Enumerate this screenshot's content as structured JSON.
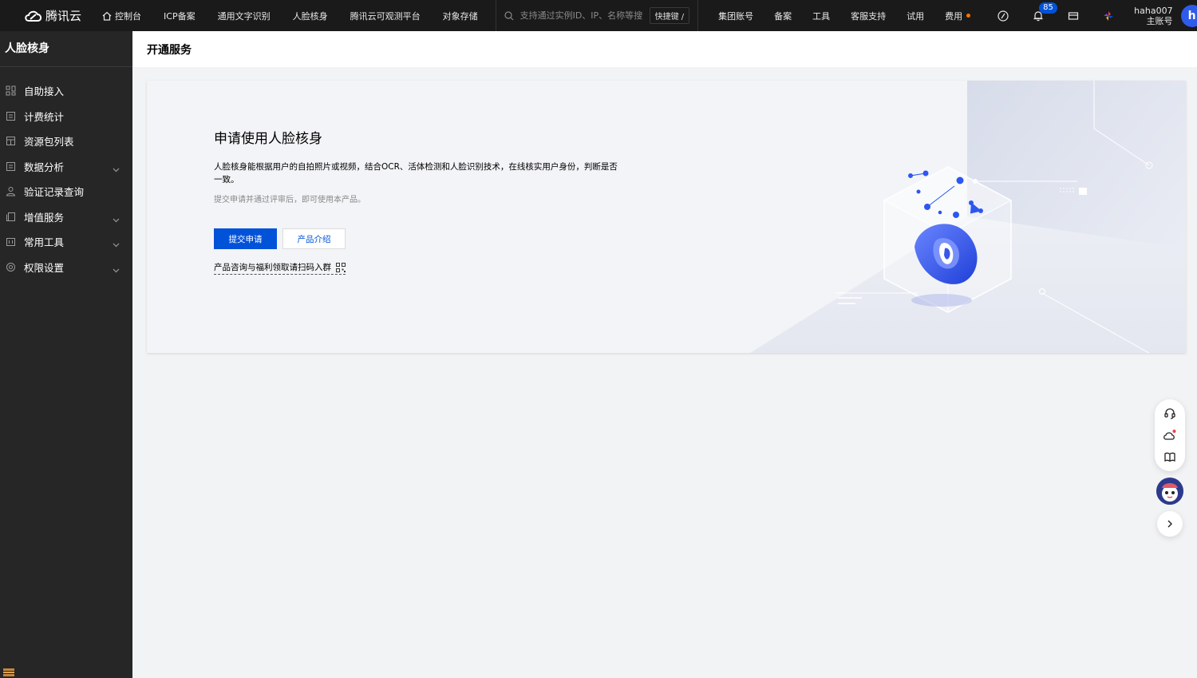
{
  "topbar": {
    "logo_text": "腾讯云",
    "nav": [
      {
        "label": "控制台",
        "icon": "home-icon"
      },
      {
        "label": "ICP备案"
      },
      {
        "label": "通用文字识别"
      },
      {
        "label": "人脸核身"
      },
      {
        "label": "腾讯云可观测平台"
      },
      {
        "label": "对象存储"
      }
    ],
    "search_placeholder": "支持通过实例ID、IP、名称等搜索",
    "search_shortcut": "快捷键 /",
    "right_nav": [
      "集团账号",
      "备案",
      "工具",
      "客服支持",
      "试用",
      "费用"
    ],
    "notification_count": "85",
    "username": "haha007",
    "account_type": "主账号",
    "avatar_letter": "h"
  },
  "sidebar": {
    "title": "人脸核身",
    "items": [
      {
        "label": "自助接入",
        "icon": "grid-icon",
        "expandable": false
      },
      {
        "label": "计费统计",
        "icon": "document-icon",
        "expandable": false
      },
      {
        "label": "资源包列表",
        "icon": "package-icon",
        "expandable": false
      },
      {
        "label": "数据分析",
        "icon": "document-icon",
        "expandable": true
      },
      {
        "label": "验证记录查询",
        "icon": "user-icon",
        "expandable": false
      },
      {
        "label": "增值服务",
        "icon": "copy-icon",
        "expandable": true
      },
      {
        "label": "常用工具",
        "icon": "toolbox-icon",
        "expandable": true
      },
      {
        "label": "权限设置",
        "icon": "settings-icon",
        "expandable": true
      }
    ]
  },
  "main": {
    "page_title": "开通服务",
    "card": {
      "heading": "申请使用人脸核身",
      "description": "人脸核身能根据用户的自拍照片或视频，结合OCR、活体检测和人脸识别技术，在线核实用户身份，判断是否一致。",
      "note": "提交申请并通过评审后，即可使用本产品。",
      "primary_button": "提交申请",
      "secondary_button": "产品介绍",
      "qr_link": "产品咨询与福利领取请扫码入群"
    }
  },
  "colors": {
    "accent": "#0052d9",
    "topbar_bg": "#1a1a1a",
    "sidebar_bg": "#262626",
    "page_bg": "#f2f3f5"
  }
}
